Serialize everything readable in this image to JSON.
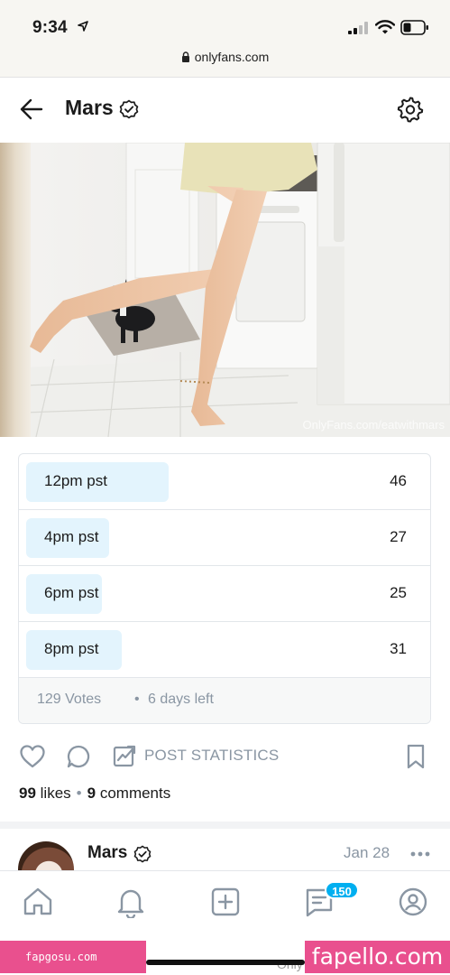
{
  "status_bar": {
    "time": "9:34",
    "url": "onlyfans.com"
  },
  "header": {
    "title": "Mars"
  },
  "media": {
    "watermark": "OnlyFans.com/eatwithmars"
  },
  "poll": {
    "options": [
      {
        "label": "12pm pst",
        "votes": "46",
        "fill_fraction": 0.36
      },
      {
        "label": "4pm pst",
        "votes": "27",
        "fill_fraction": 0.21
      },
      {
        "label": "6pm pst",
        "votes": "25",
        "fill_fraction": 0.19
      },
      {
        "label": "8pm pst",
        "votes": "31",
        "fill_fraction": 0.24
      }
    ],
    "total_votes": "129 Votes",
    "separator": "•",
    "time_left": "6 days left"
  },
  "actions": {
    "stats_label": "POST STATISTICS",
    "likes_count": "99",
    "likes_label": "likes",
    "separator": "•",
    "comments_count": "9",
    "comments_label": "comments"
  },
  "next_post": {
    "author": "Mars",
    "date": "Jan 28"
  },
  "tab_bar": {
    "messages_badge": "150"
  },
  "overlays": {
    "left_watermark": "fapgosu.com",
    "right_watermark": "fapello.com",
    "browser_hint": "Only"
  },
  "colors": {
    "accent": "#00aff0",
    "poll_fill": "#e3f4fd",
    "muted_text": "#8a96a3",
    "watermark_pink": "#e9508e"
  }
}
